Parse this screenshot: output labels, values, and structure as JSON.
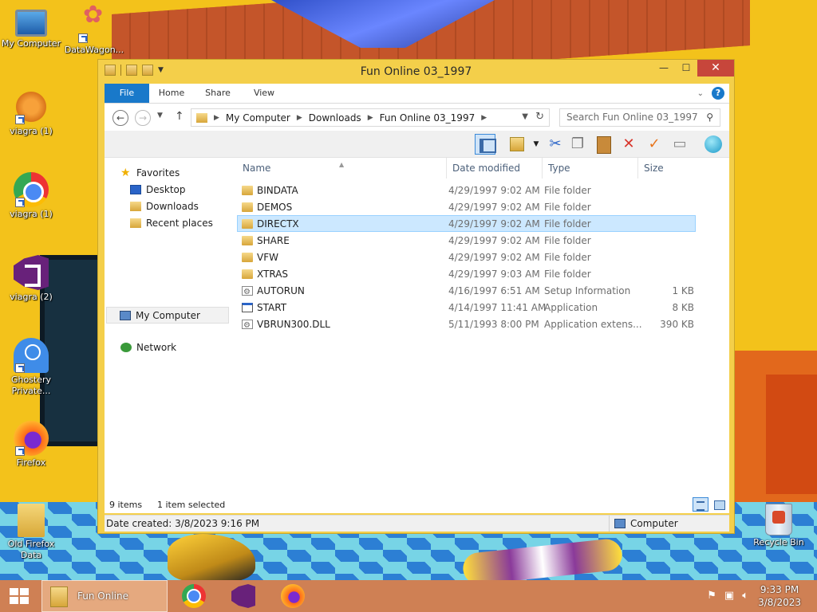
{
  "desktop": {
    "icons": [
      {
        "label": "My Computer",
        "icon": "computer-icon"
      },
      {
        "label": "DataWagon...",
        "icon": "datawagon-icon"
      },
      {
        "label": "viagra (1)",
        "icon": "star-icon"
      },
      {
        "label": "viagra (1)",
        "icon": "chrome-icon"
      },
      {
        "label": "viagra (2)",
        "icon": "visual-studio-icon"
      },
      {
        "label": "Ghostery Private...",
        "icon": "ghostery-icon"
      },
      {
        "label": "Firefox",
        "icon": "firefox-icon"
      },
      {
        "label": "Old Firefox Data",
        "icon": "folder-icon"
      },
      {
        "label": "Recycle Bin",
        "icon": "recycle-bin-icon"
      }
    ]
  },
  "window": {
    "title": "Fun Online 03_1997",
    "ribbon_tabs": [
      "File",
      "Home",
      "Share",
      "View"
    ],
    "address": {
      "crumbs": [
        "My Computer",
        "Downloads",
        "Fun Online 03_1997"
      ]
    },
    "search": {
      "placeholder": "Search Fun Online 03_1997"
    },
    "nav_pane": {
      "favorites_label": "Favorites",
      "favorites": [
        "Desktop",
        "Downloads",
        "Recent places"
      ],
      "computer_label": "My Computer",
      "network_label": "Network"
    },
    "columns": {
      "name": "Name",
      "date": "Date modified",
      "type": "Type",
      "size": "Size"
    },
    "files": [
      {
        "name": "BINDATA",
        "date": "4/29/1997 9:02 AM",
        "type": "File folder",
        "size": "",
        "icon": "folder-icon"
      },
      {
        "name": "DEMOS",
        "date": "4/29/1997 9:02 AM",
        "type": "File folder",
        "size": "",
        "icon": "folder-icon"
      },
      {
        "name": "DIRECTX",
        "date": "4/29/1997 9:02 AM",
        "type": "File folder",
        "size": "",
        "icon": "folder-icon",
        "selected": true
      },
      {
        "name": "SHARE",
        "date": "4/29/1997 9:02 AM",
        "type": "File folder",
        "size": "",
        "icon": "folder-icon"
      },
      {
        "name": "VFW",
        "date": "4/29/1997 9:02 AM",
        "type": "File folder",
        "size": "",
        "icon": "folder-icon"
      },
      {
        "name": "XTRAS",
        "date": "4/29/1997 9:03 AM",
        "type": "File folder",
        "size": "",
        "icon": "folder-icon"
      },
      {
        "name": "AUTORUN",
        "date": "4/16/1997 6:51 AM",
        "type": "Setup Information",
        "size": "1 KB",
        "icon": "setup-info-icon"
      },
      {
        "name": "START",
        "date": "4/14/1997 11:41 AM",
        "type": "Application",
        "size": "8 KB",
        "icon": "application-icon"
      },
      {
        "name": "VBRUN300.DLL",
        "date": "5/11/1993 8:00 PM",
        "type": "Application extens...",
        "size": "390 KB",
        "icon": "dll-icon"
      }
    ],
    "status": {
      "count": "9 items",
      "selection": "1 item selected"
    },
    "details": {
      "date_created": "Date created: 3/8/2023 9:16 PM",
      "location": "Computer"
    }
  },
  "taskbar": {
    "active_task": "Fun Online 03_1997",
    "time": "9:33 PM",
    "date": "3/8/2023"
  },
  "colors": {
    "accent": "#1979ca",
    "selection": "#cce8ff",
    "title_bar": "#f4cf4a",
    "close": "#c7463b"
  }
}
